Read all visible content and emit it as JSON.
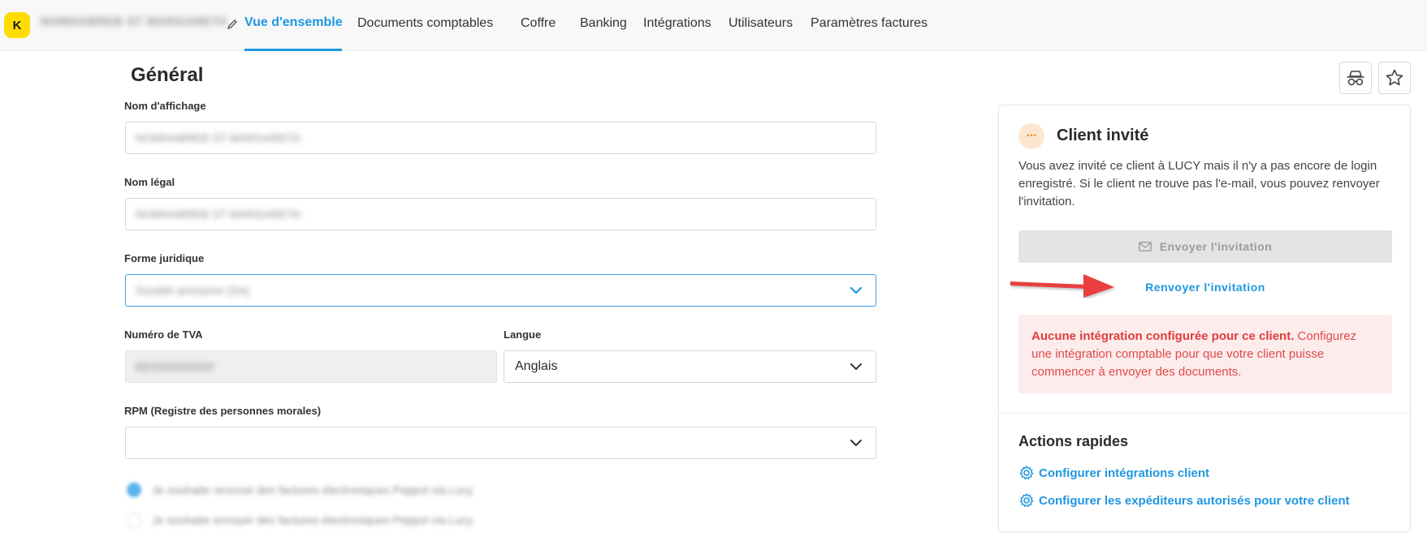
{
  "header": {
    "avatar_letter": "K",
    "client_name": "NOMHABREB ST MARGARETA",
    "tabs": [
      {
        "label": "Vue d'ensemble",
        "active": true
      },
      {
        "label": "Documents comptables"
      },
      {
        "label": "Coffre"
      },
      {
        "label": "Banking"
      },
      {
        "label": "Intégrations"
      },
      {
        "label": "Utilisateurs"
      },
      {
        "label": "Paramètres factures"
      }
    ]
  },
  "form": {
    "section_title": "Général",
    "display_name": {
      "label": "Nom d'affichage",
      "value": "NOMHABREB ST MARGARETA"
    },
    "legal_name": {
      "label": "Nom légal",
      "value": "NOMHABREB ST MARGARETA"
    },
    "legal_form": {
      "label": "Forme juridique",
      "value": "Société anonyme (SA)"
    },
    "vat": {
      "label": "Numéro de TVA",
      "value": "BE0000000000"
    },
    "language": {
      "label": "Langue",
      "value": "Anglais"
    },
    "rpm": {
      "label": "RPM (Registre des personnes morales)",
      "value": ""
    },
    "checkbox_receive": "Je souhaite recevoir des factures électroniques Peppol via Lucy",
    "checkbox_send": "Je souhaite envoyer des factures électroniques Peppol via Lucy"
  },
  "card": {
    "status_glyph": "···",
    "title": "Client invité",
    "description": "Vous avez invité ce client à LUCY mais il n'y a pas encore de login enregistré. Si le client ne trouve pas l'e-mail, vous pouvez renvoyer l'invitation.",
    "send_button": "Envoyer l'invitation",
    "resend_link": "Renvoyer l'invitation",
    "alert_bold": "Aucune intégration configurée pour ce client.",
    "alert_text": " Configurez une intégration comptable pour que votre client puisse commencer à envoyer des documents.",
    "quick_actions_title": "Actions rapides",
    "quick_actions": [
      "Configurer intégrations client",
      "Configurer les expéditeurs autorisés pour votre client"
    ]
  },
  "colors": {
    "accent": "#1f97e0",
    "avatar": "#ffdd00",
    "alert_bg": "#fdecec",
    "alert_text": "#e03c3c",
    "arrow": "#e84141"
  },
  "icons": [
    "pencil-icon",
    "incognito-icon",
    "star-icon",
    "chevron-down-icon",
    "mail-icon",
    "gear-icon"
  ]
}
